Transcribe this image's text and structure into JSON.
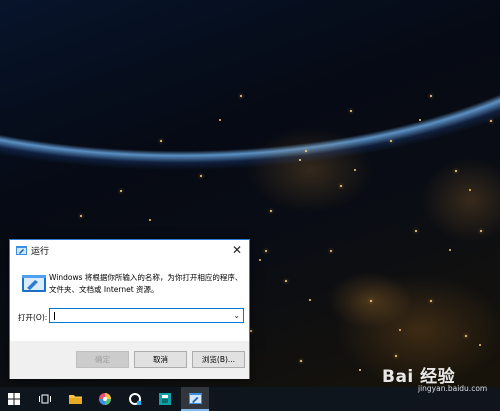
{
  "dialog": {
    "title": "运行",
    "close_glyph": "✕",
    "description_line1": "Windows 将根据你所输入的名称，为你打开相应的程序、",
    "description_line2": "文件夹、文档或 Internet 资源。",
    "open_label": "打开(O):",
    "open_value": "",
    "buttons": {
      "ok": "确定",
      "cancel": "取消",
      "browse": "浏览(B)..."
    }
  },
  "taskbar": {
    "items": [
      {
        "name": "start-button",
        "icon": "windows-logo-icon"
      },
      {
        "name": "task-view-button",
        "icon": "task-view-icon"
      },
      {
        "name": "file-explorer-button",
        "icon": "folder-icon"
      },
      {
        "name": "color-app-button",
        "icon": "color-wheel-icon"
      },
      {
        "name": "browser-button",
        "icon": "browser-icon"
      },
      {
        "name": "app-button",
        "icon": "app-icon"
      },
      {
        "name": "run-button",
        "icon": "run-icon"
      }
    ]
  },
  "watermark": {
    "main": "Bai 经验",
    "sub": "jingyan.baidu.com"
  },
  "colors": {
    "accent": "#0078d7",
    "dialog_border": "#2b7bd3",
    "taskbar": "#101820"
  }
}
